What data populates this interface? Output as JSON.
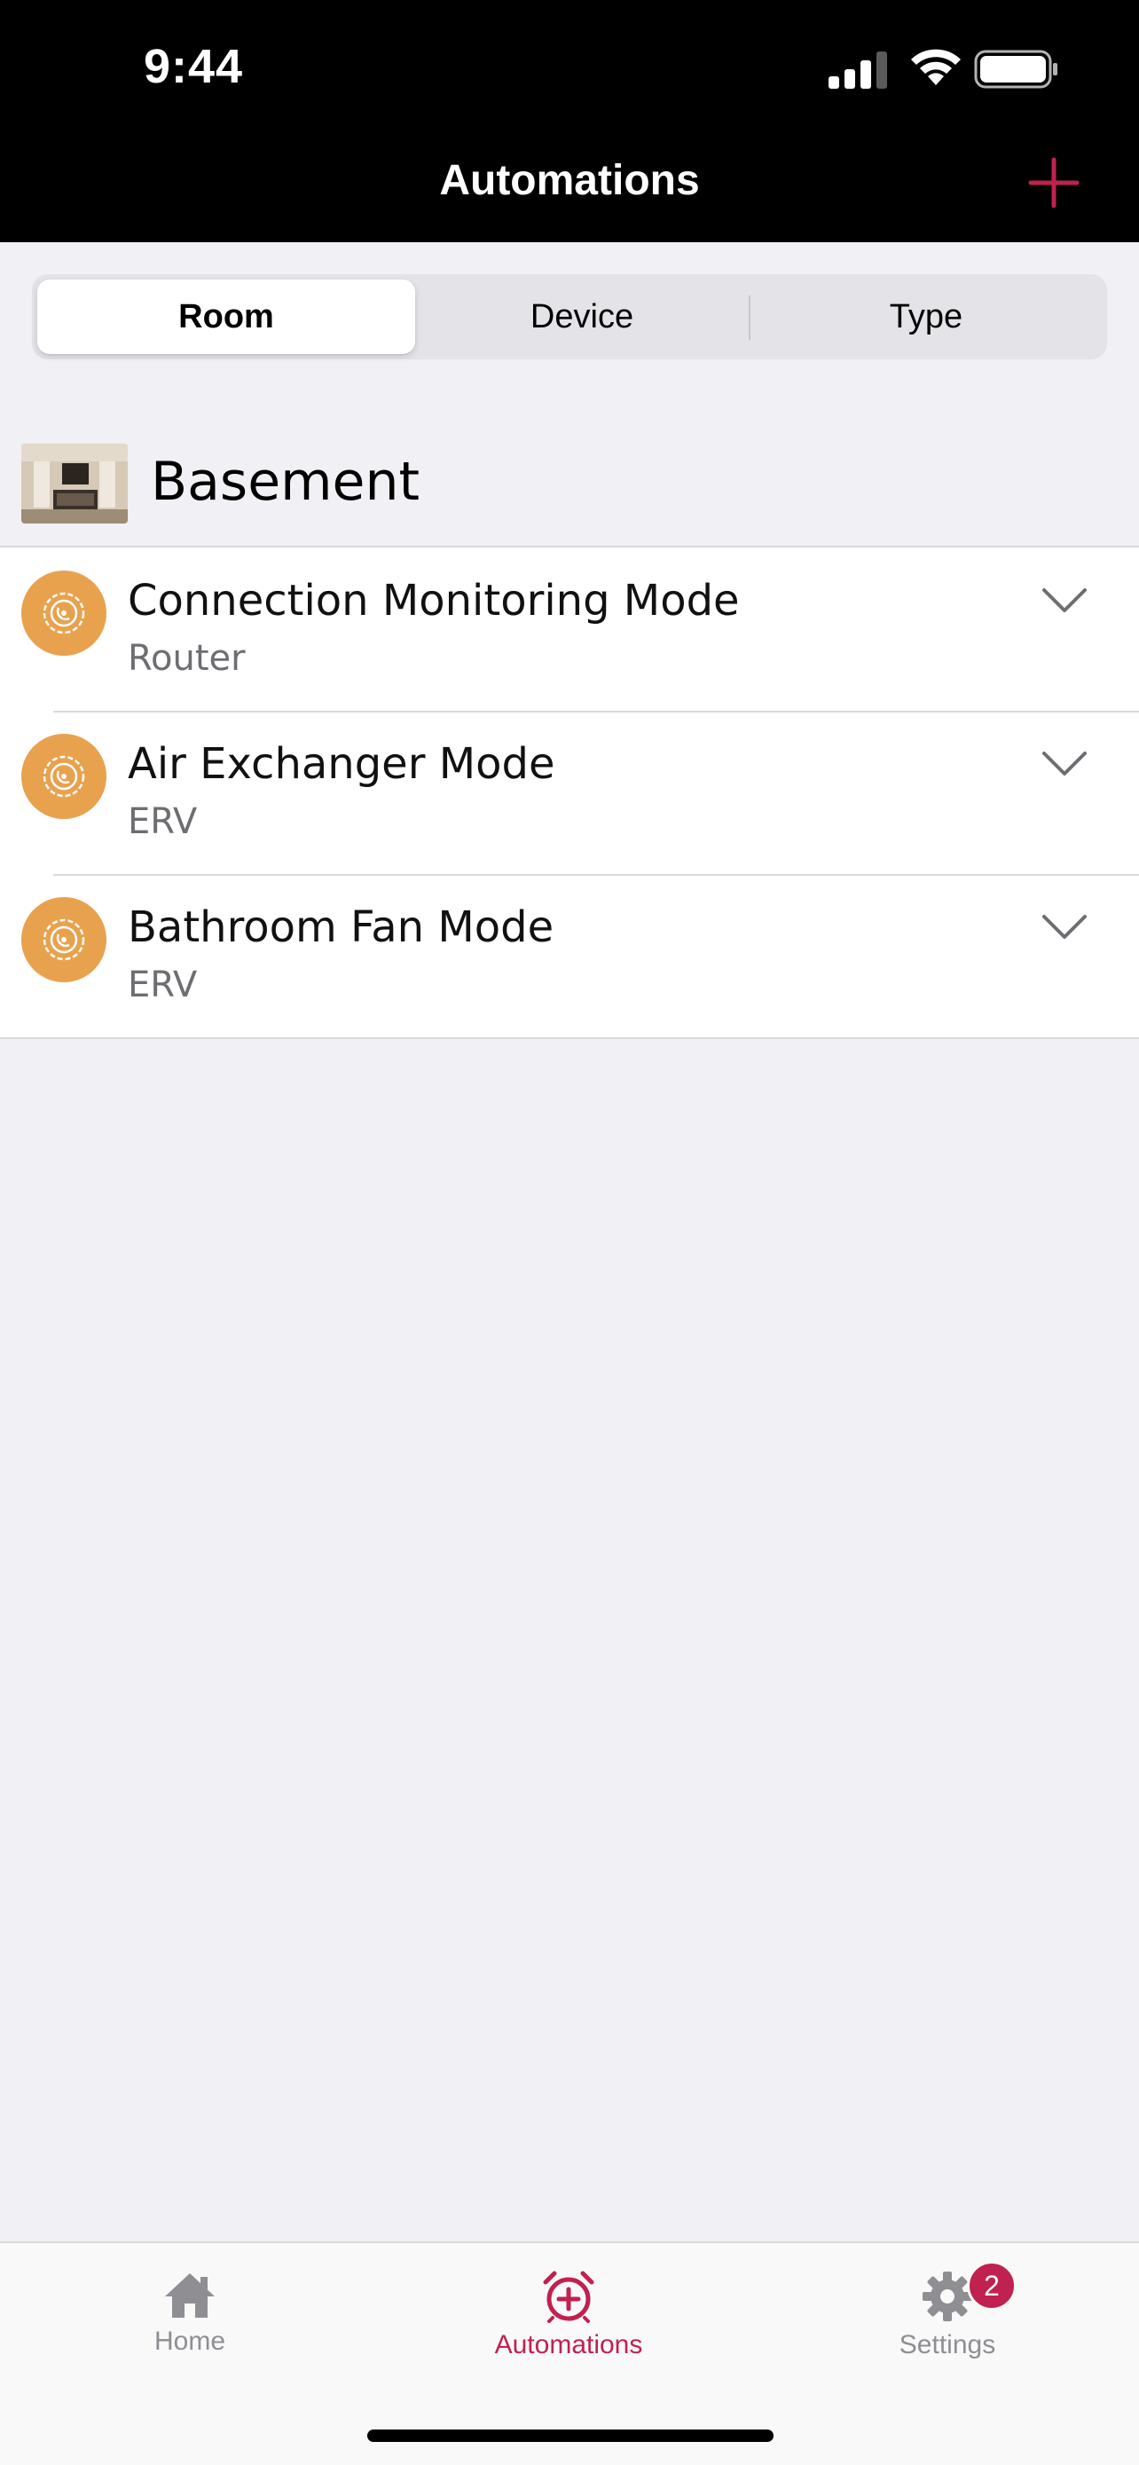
{
  "status_bar": {
    "time": "9:44"
  },
  "nav": {
    "title": "Automations",
    "add_icon": "plus-icon"
  },
  "colors": {
    "accent": "#c0214f",
    "automation_icon_bg": "#e8a24e",
    "nav_bg": "#000000",
    "page_bg": "#f0f0f5"
  },
  "segments": [
    {
      "label": "Room",
      "selected": true
    },
    {
      "label": "Device",
      "selected": false
    },
    {
      "label": "Type",
      "selected": false
    }
  ],
  "room": {
    "name": "Basement"
  },
  "automations": [
    {
      "title": "Connection Monitoring Mode",
      "device": "Router",
      "icon": "automation-gear-icon"
    },
    {
      "title": "Air Exchanger Mode",
      "device": "ERV",
      "icon": "automation-gear-icon"
    },
    {
      "title": "Bathroom Fan Mode",
      "device": "ERV",
      "icon": "automation-gear-icon"
    }
  ],
  "tabs": [
    {
      "label": "Home",
      "icon": "home-icon",
      "active": false
    },
    {
      "label": "Automations",
      "icon": "alarm-clock-plus-icon",
      "active": true
    },
    {
      "label": "Settings",
      "icon": "gear-icon",
      "active": false,
      "badge": "2"
    }
  ]
}
